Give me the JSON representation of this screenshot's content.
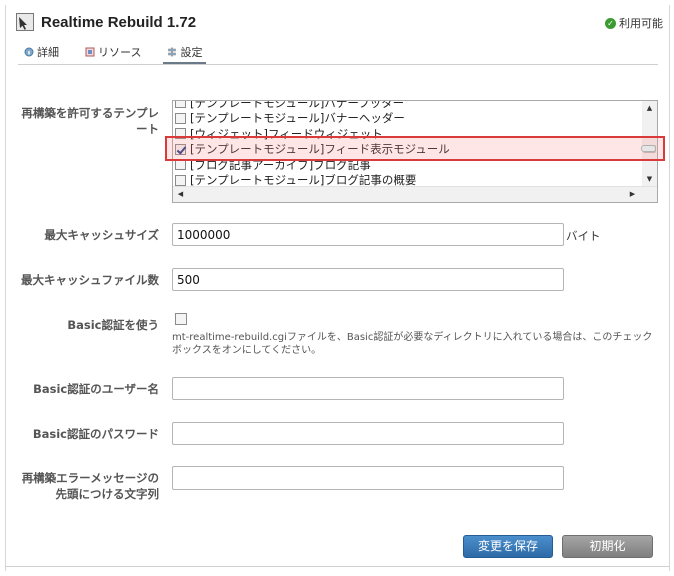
{
  "header": {
    "title": "Realtime Rebuild 1.72",
    "status": "利用可能",
    "status_color": "#3b9b2f"
  },
  "tabs": [
    {
      "label": "詳細",
      "icon": "info-icon"
    },
    {
      "label": "リソース",
      "icon": "resource-icon"
    },
    {
      "label": "設定",
      "icon": "settings-icon",
      "active": true
    }
  ],
  "form": {
    "templates": {
      "label": "再構築を許可するテンプレート",
      "options": [
        {
          "label": "[テンプレートモジュール]バナーフッター",
          "checked": false
        },
        {
          "label": "[テンプレートモジュール]バナーヘッダー",
          "checked": false
        },
        {
          "label": "[ウィジェット]フィードウィジェット",
          "checked": false
        },
        {
          "label": "[テンプレートモジュール]フィード表示モジュール",
          "checked": true
        },
        {
          "label": "[ブログ記事アーカイブ]ブログ記事",
          "checked": false
        },
        {
          "label": "[テンプレートモジュール]ブログ記事の概要",
          "checked": false
        }
      ]
    },
    "max_cache_size": {
      "label": "最大キャッシュサイズ",
      "value": "1000000",
      "unit": "バイト"
    },
    "max_cache_files": {
      "label": "最大キャッシュファイル数",
      "value": "500"
    },
    "basic_auth": {
      "label": "Basic認証を使う",
      "checked": false,
      "help": "mt-realtime-rebuild.cgiファイルを、Basic認証が必要なディレクトリに入れている場合は、このチェックボックスをオンにしてください。"
    },
    "basic_user": {
      "label": "Basic認証のユーザー名",
      "value": ""
    },
    "basic_password": {
      "label": "Basic認証のパスワード",
      "value": ""
    },
    "error_prefix": {
      "label": "再構築エラーメッセージの先頭につける文字列",
      "value": ""
    }
  },
  "buttons": {
    "save": "変更を保存",
    "reset": "初期化"
  },
  "colors": {
    "save_button": "#3a7dbd",
    "highlight_border": "#d93a3a"
  }
}
